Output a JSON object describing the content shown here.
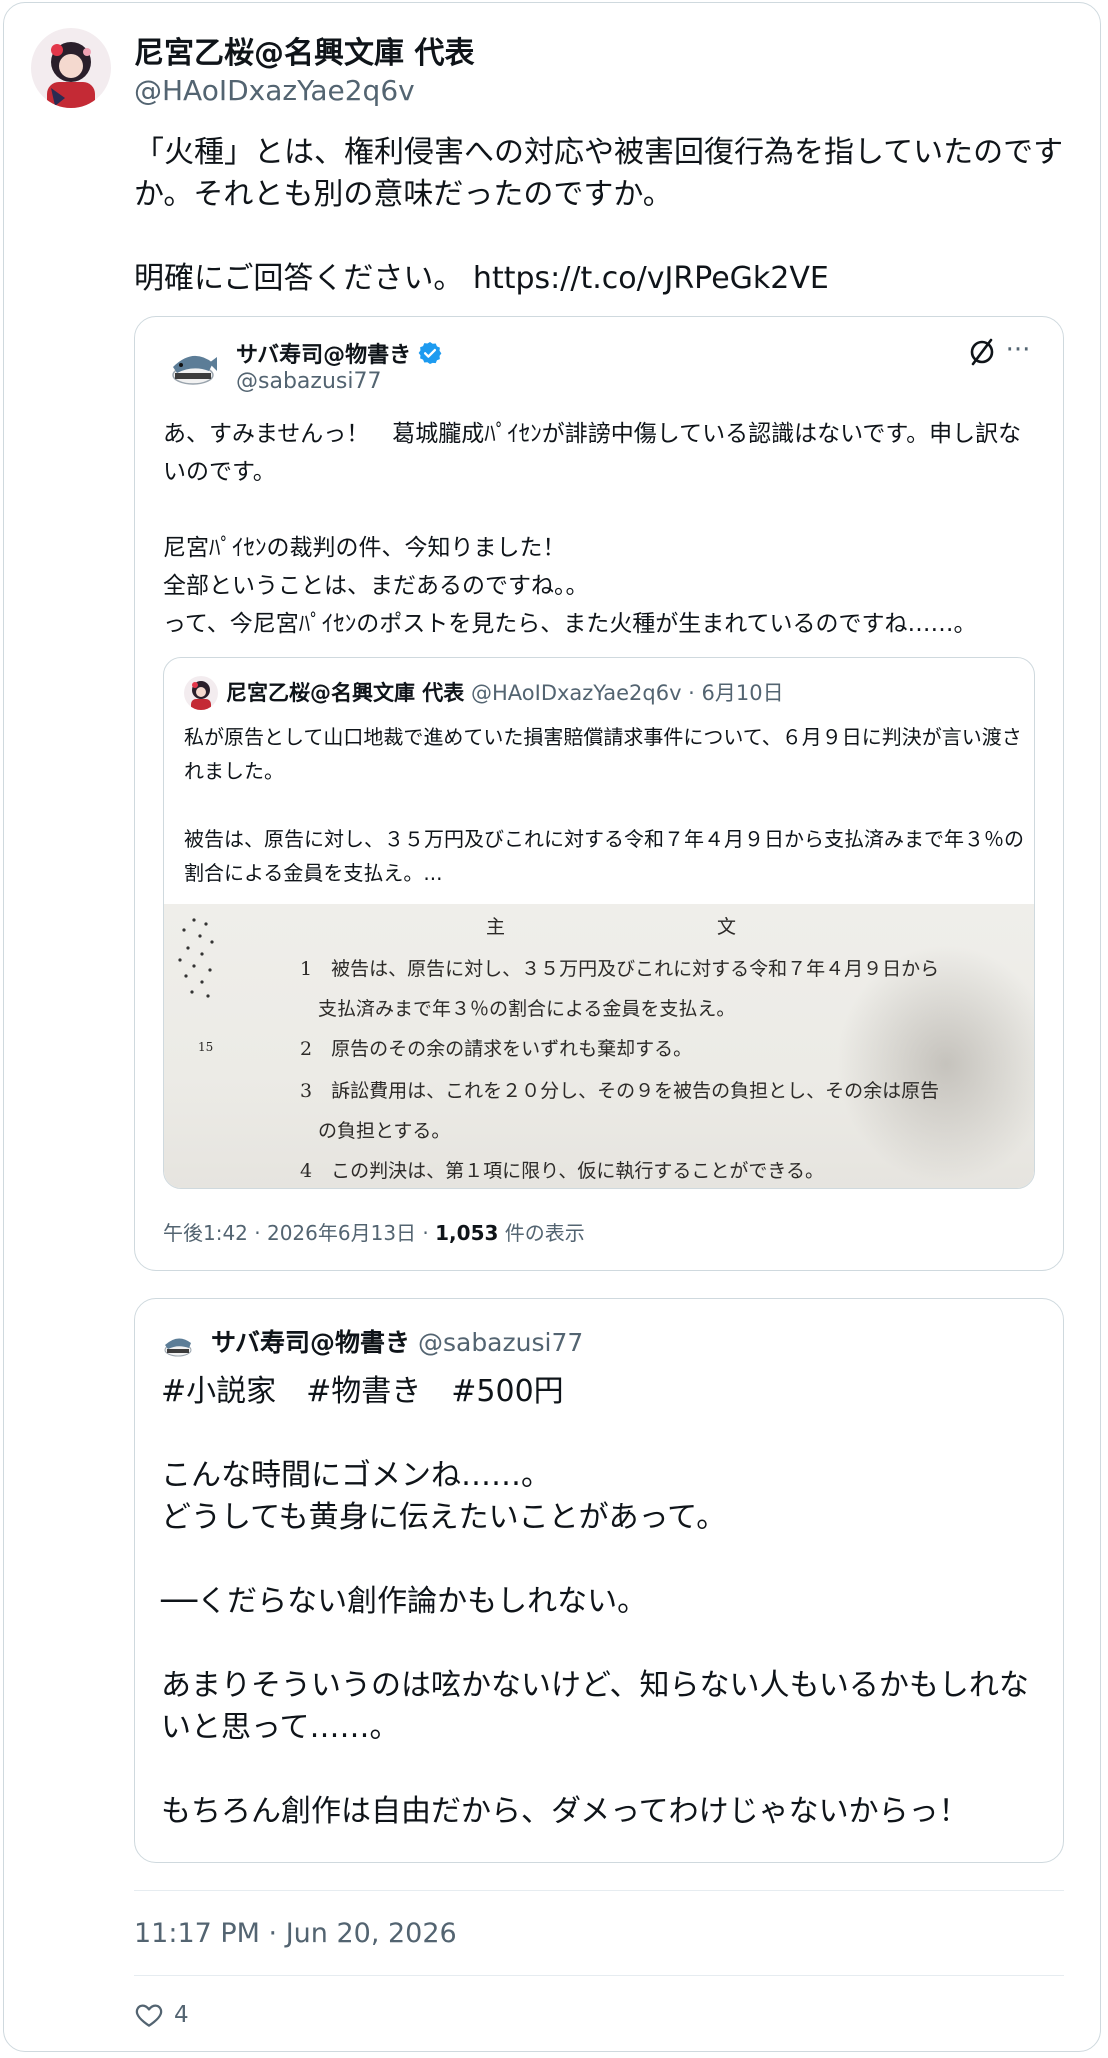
{
  "tweet": {
    "author_name": "尼宮乙桜@名興文庫 代表",
    "author_handle": "@HAoIDxazYae2q6v",
    "text": "「火種」とは、権利侵害への対応や被害回復行為を指していたのですか。それとも別の意味だったのですか。\n\n明確にご回答ください。 https://t.co/vJRPeGk2VE",
    "timestamp": "11:17 PM · Jun 20, 2026",
    "like_count": "4"
  },
  "quote1": {
    "author_name": "サバ寿司@物書き",
    "author_handle": "@sabazusi77",
    "more_label": "···",
    "text": "あ、すみませんっ！　葛城朧成ﾊﾟｲｾﾝが誹謗中傷している認識はないです。申し訳ないのです。\n\n尼宮ﾊﾟｲｾﾝの裁判の件、今知りました！\n全部ということは、まだあるのですね。。\nって、今尼宮ﾊﾟｲｾﾝのポストを見たら、また火種が生まれているのですね……。",
    "meta_time": "午後1:42 · 2026年6月13日 · ",
    "meta_views_count": "1,053",
    "meta_views_label": " 件の表示"
  },
  "nested": {
    "author_name": "尼宮乙桜@名興文庫 代表",
    "meta": " @HAoIDxazYae2q6v · 6月10日",
    "text": "私が原告として山口地裁で進めていた損害賠償請求事件について、６月９日に判決が言い渡されました。\n\n被告は、原告に対し、３５万円及びこれに対する令和７年４月９日から支払済みまで年３％の割合による金員を支払え。...",
    "document_lines": [
      "主　　　　　　　　　　文",
      "1　被告は、原告に対し、３５万円及びこれに対する令和７年４月９日から",
      "支払済みまで年３％の割合による金員を支払え。",
      "15",
      "2　原告のその余の請求をいずれも棄却する。",
      "3　訴訟費用は、これを２０分し、その９を被告の負担とし、その余は原告",
      "の負担とする。",
      "4　この判決は、第１項に限り、仮に執行することができる。"
    ]
  },
  "quote2": {
    "author_name": "サバ寿司@物書き",
    "author_handle": "@sabazusi77",
    "text": "#小説家　#物書き　#500円\n\nこんな時間にゴメンね……。\nどうしても黄身に伝えたいことがあって。\n\n──くだらない創作論かもしれない。\n\nあまりそういうのは呟かないけど、知らない人もいるかもしれないと思って……。\n\nもちろん創作は自由だから、ダメってわけじゃないからっ！"
  },
  "colors": {
    "text": "#0f1419",
    "secondary": "#536471",
    "border": "#cfd9de",
    "verified": "#1d9bf0"
  }
}
